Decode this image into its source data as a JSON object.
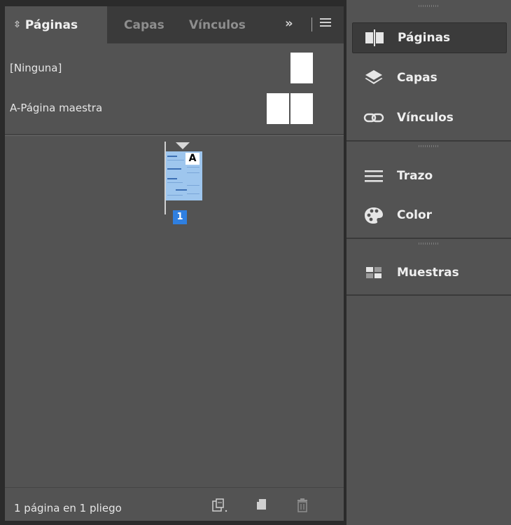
{
  "pages_panel": {
    "tabs": [
      {
        "label": "Páginas",
        "active": true
      },
      {
        "label": "Capas",
        "active": false
      },
      {
        "label": "Vínculos",
        "active": false
      }
    ],
    "overflow_label": "»",
    "masters": [
      {
        "label": "[Ninguna]",
        "thumb": "single"
      },
      {
        "label": "A-Página maestra",
        "thumb": "spread"
      }
    ],
    "document_page": {
      "number": "1",
      "master_prefix": "A"
    },
    "status_text": "1 página en 1 pliego",
    "status_icons": [
      "page-size-icon",
      "new-page-icon",
      "trash-icon"
    ]
  },
  "dock": {
    "groups": [
      {
        "items": [
          {
            "label": "Páginas",
            "icon": "pages-icon",
            "active": true
          },
          {
            "label": "Capas",
            "icon": "layers-icon",
            "active": false
          },
          {
            "label": "Vínculos",
            "icon": "links-icon",
            "active": false
          }
        ]
      },
      {
        "items": [
          {
            "label": "Trazo",
            "icon": "stroke-icon",
            "active": false
          },
          {
            "label": "Color",
            "icon": "color-palette-icon",
            "active": false
          }
        ]
      },
      {
        "items": [
          {
            "label": "Muestras",
            "icon": "swatches-icon",
            "active": false
          }
        ]
      }
    ]
  },
  "colors": {
    "panel_bg": "#535353",
    "tabbar_bg": "#3a3a3a",
    "accent_blue": "#2f7fe0",
    "page_thumb_blue": "#9ec6ee"
  }
}
